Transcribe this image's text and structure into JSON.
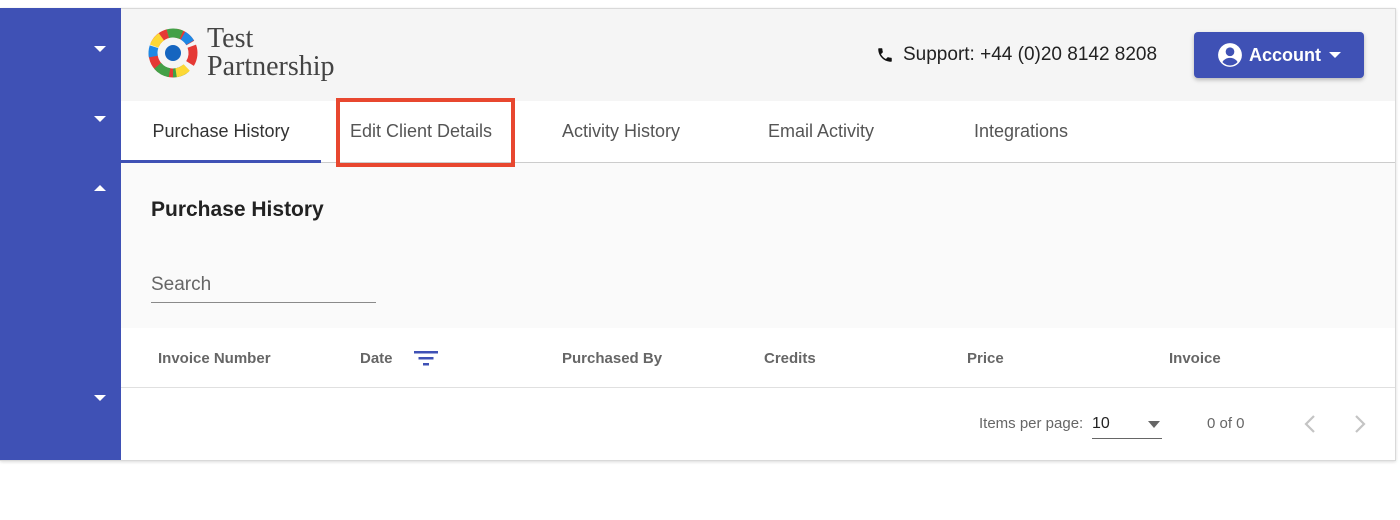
{
  "brand": {
    "line1": "Test",
    "line2": "Partnership"
  },
  "header": {
    "support_text": "Support: +44 (0)20 8142 8208",
    "account_label": "Account"
  },
  "tabs": [
    {
      "label": "Purchase History",
      "active": true
    },
    {
      "label": "Edit Client Details",
      "active": false
    },
    {
      "label": "Activity History",
      "active": false
    },
    {
      "label": "Email Activity",
      "active": false
    },
    {
      "label": "Integrations",
      "active": false
    }
  ],
  "content": {
    "title": "Purchase History",
    "search_placeholder": "Search"
  },
  "table": {
    "columns": [
      "Invoice Number",
      "Date",
      "Purchased By",
      "Credits",
      "Price",
      "Invoice"
    ]
  },
  "paginator": {
    "items_per_page_label": "Items per page:",
    "items_per_page_value": "10",
    "range_label": "0 of 0"
  },
  "colors": {
    "primary": "#3f51b5",
    "highlight": "#e8472f"
  },
  "icons": {
    "sidebar": [
      "chevron-down-icon",
      "chevron-down-icon",
      "chevron-up-icon",
      "chevron-down-icon"
    ],
    "support": "phone-icon",
    "account": "account-circle-icon",
    "sort": "filter-list-icon"
  }
}
